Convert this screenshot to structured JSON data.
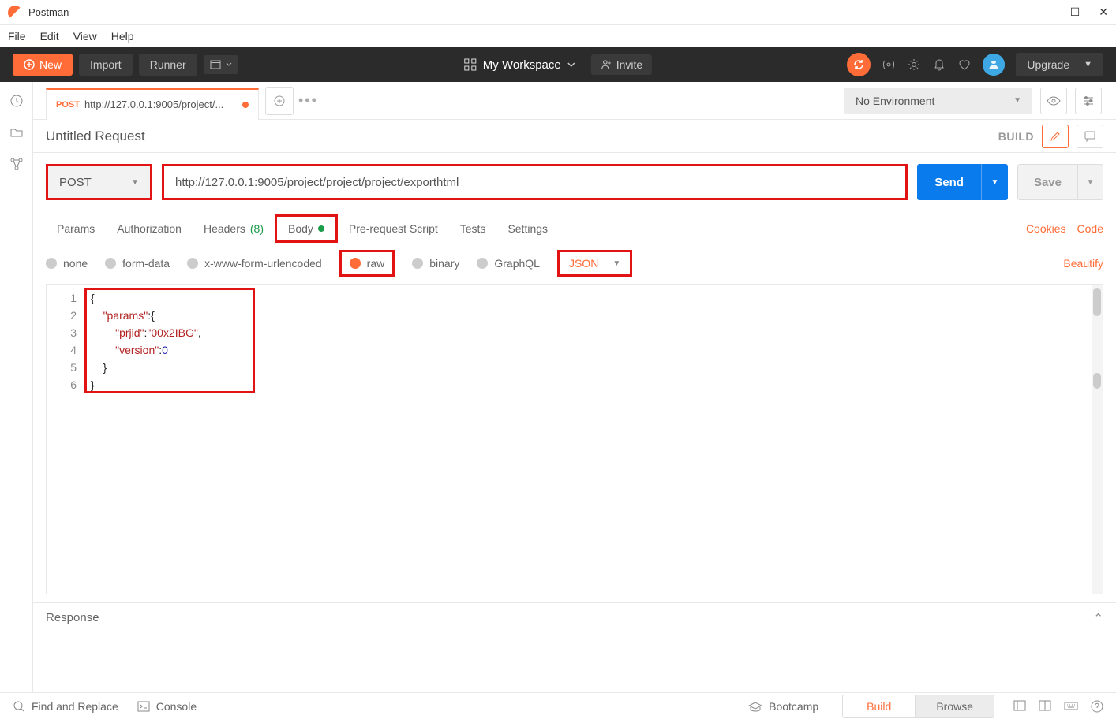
{
  "app": {
    "title": "Postman"
  },
  "menu": {
    "file": "File",
    "edit": "Edit",
    "view": "View",
    "help": "Help"
  },
  "toolbar": {
    "new": "New",
    "import": "Import",
    "runner": "Runner",
    "workspace": "My Workspace",
    "invite": "Invite",
    "upgrade": "Upgrade"
  },
  "tabs": {
    "request_method": "POST",
    "request_label": "http://127.0.0.1:9005/project/...",
    "environment": "No Environment"
  },
  "request": {
    "name": "Untitled Request",
    "build_label": "BUILD",
    "method": "POST",
    "url": "http://127.0.0.1:9005/project/project/project/exporthtml",
    "send": "Send",
    "save": "Save"
  },
  "subtabs": {
    "params": "Params",
    "authorization": "Authorization",
    "headers": "Headers",
    "headers_count": "(8)",
    "body": "Body",
    "prerequest": "Pre-request Script",
    "tests": "Tests",
    "settings": "Settings",
    "cookies": "Cookies",
    "code": "Code"
  },
  "bodytype": {
    "none": "none",
    "formdata": "form-data",
    "urlencoded": "x-www-form-urlencoded",
    "raw": "raw",
    "binary": "binary",
    "graphql": "GraphQL",
    "json": "JSON",
    "beautify": "Beautify"
  },
  "editor": {
    "lines": [
      "1",
      "2",
      "3",
      "4",
      "5",
      "6"
    ],
    "body_json": {
      "params": {
        "prjid": "00x2IBG",
        "version": 0
      }
    },
    "l1": "{",
    "l2a": "    ",
    "l2b": "\"params\"",
    "l2c": ":{",
    "l3a": "        ",
    "l3b": "\"prjid\"",
    "l3c": ":",
    "l3d": "\"00x2IBG\"",
    "l3e": ",",
    "l4a": "        ",
    "l4b": "\"version\"",
    "l4c": ":",
    "l4d": "0",
    "l5a": "    }",
    "l6": "}"
  },
  "response": {
    "label": "Response"
  },
  "footer": {
    "find": "Find and Replace",
    "console": "Console",
    "bootcamp": "Bootcamp",
    "build": "Build",
    "browse": "Browse"
  }
}
